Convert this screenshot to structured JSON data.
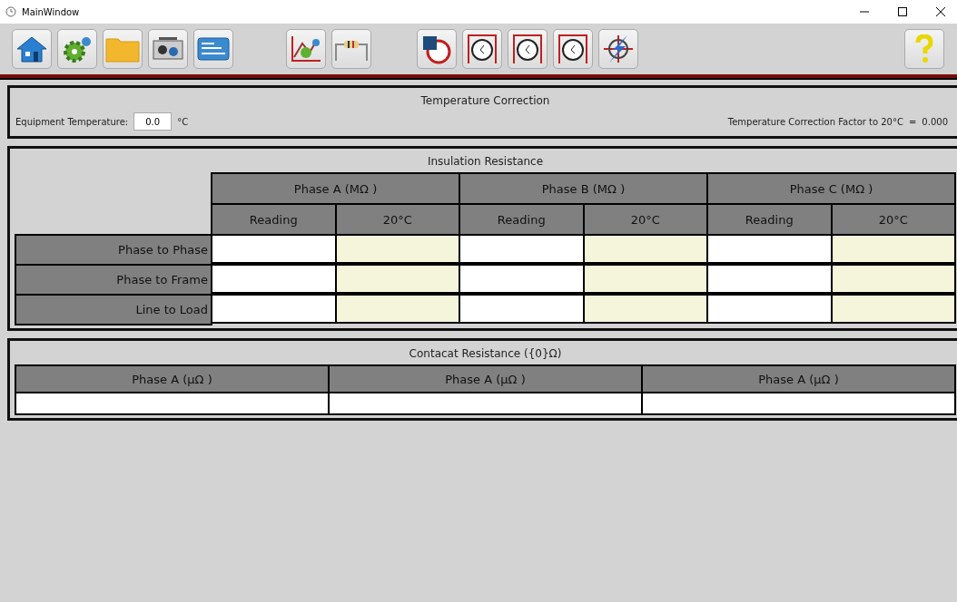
{
  "window": {
    "title": "MainWindow"
  },
  "temperature_correction": {
    "title": "Temperature Correction",
    "equipment_label": "Equipment Temperature:",
    "equipment_value": "0.0",
    "unit": "°C",
    "factor_label": "Temperature Correction Factor to 20°C",
    "factor_equals": "=",
    "factor_value": "0.000"
  },
  "insulation": {
    "title": "Insulation Resistance",
    "phases": [
      {
        "label": "Phase A (MΩ )",
        "columns": [
          {
            "label": "Reading",
            "kind": "reading"
          },
          {
            "label": "20°C",
            "kind": "corrected"
          }
        ]
      },
      {
        "label": "Phase B (MΩ )",
        "columns": [
          {
            "label": "Reading",
            "kind": "reading"
          },
          {
            "label": "20°C",
            "kind": "corrected"
          }
        ]
      },
      {
        "label": "Phase C (MΩ )",
        "columns": [
          {
            "label": "Reading",
            "kind": "reading"
          },
          {
            "label": "20°C",
            "kind": "corrected"
          }
        ]
      }
    ],
    "rows": [
      "Phase to Phase",
      "Phase to Frame",
      "Line to Load"
    ]
  },
  "contact": {
    "title": "Contacat Resistance ({0}Ω)",
    "columns": [
      "Phase A (μΩ )",
      "Phase A (μΩ )",
      "Phase A (μΩ )"
    ]
  }
}
